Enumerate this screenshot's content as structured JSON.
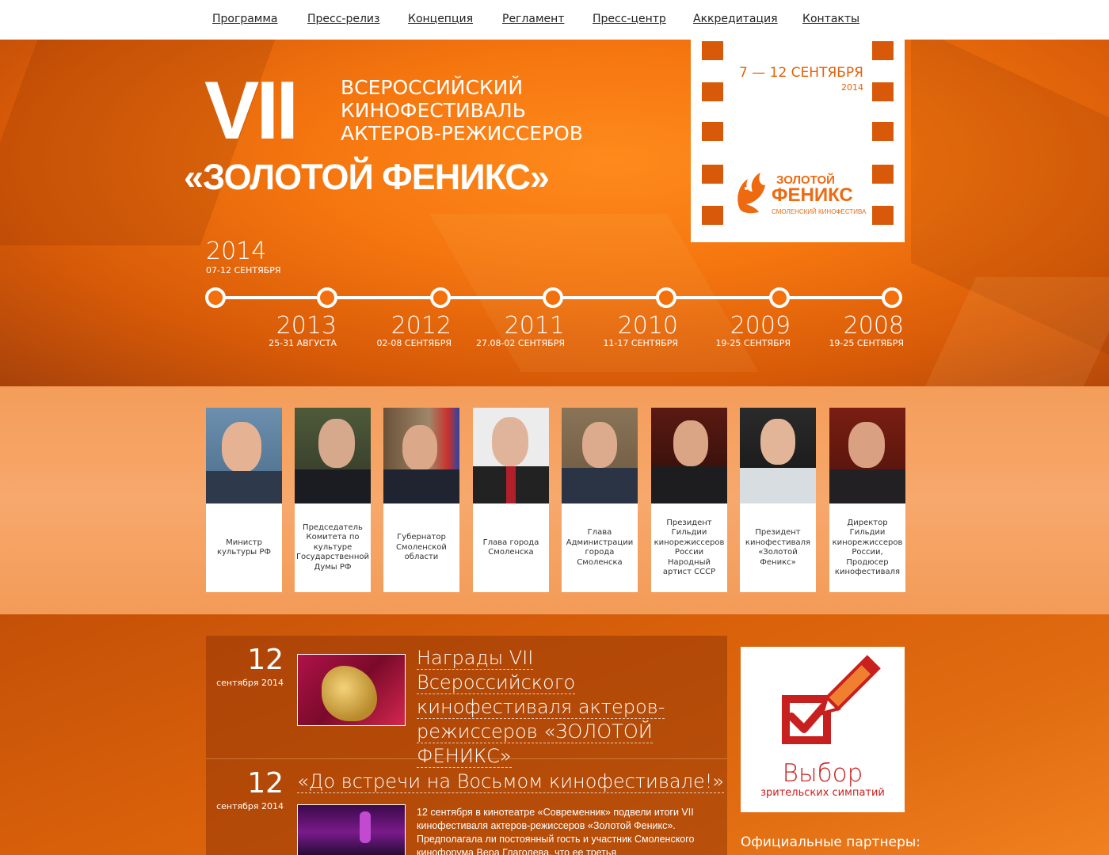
{
  "nav": {
    "items": [
      "Программа",
      "Пресс-релиз",
      "Концепция",
      "Регламент",
      "Пресс-центр",
      "Аккредитация",
      "Контакты"
    ]
  },
  "hero": {
    "numeral": "VII",
    "lines": [
      "ВСЕРОССИЙСКИЙ",
      "КИНОФЕСТИВАЛЬ",
      "АКТЕРОВ-РЕЖИССЕРОВ"
    ],
    "name": "«ЗОЛОТОЙ ФЕНИКС»",
    "film_dates": "7 — 12 СЕНТЯБРЯ",
    "film_year": "2014",
    "logo_top": "ЗОЛОТОЙ",
    "logo_main": "ФЕНИКС",
    "logo_sub": "СМОЛЕНСКИЙ КИНОФЕСТИВАЛЬ"
  },
  "timeline": {
    "current": {
      "year": "2014",
      "dates": "07-12 СЕНТЯБРЯ"
    },
    "past": [
      {
        "year": "2013",
        "dates": "25-31 АВГУСТА"
      },
      {
        "year": "2012",
        "dates": "02-08 СЕНТЯБРЯ"
      },
      {
        "year": "2011",
        "dates": "27.08-02 СЕНТЯБРЯ"
      },
      {
        "year": "2010",
        "dates": "11-17 СЕНТЯБРЯ"
      },
      {
        "year": "2009",
        "dates": "19-25 СЕНТЯБРЯ"
      },
      {
        "year": "2008",
        "dates": "19-25 СЕНТЯБРЯ"
      }
    ]
  },
  "people": [
    {
      "caption": "Министр культуры РФ"
    },
    {
      "caption": "Председатель Комитета по культуре Государственной Думы РФ"
    },
    {
      "caption": "Губернатор Смоленской области"
    },
    {
      "caption": "Глава города Смоленска"
    },
    {
      "caption": "Глава Администрации города Смоленска"
    },
    {
      "caption": "Президент Гильдии кинорежиссеров России Народный артист СССР"
    },
    {
      "caption": "Президент кинофестиваля «Золотой Феникс»"
    },
    {
      "caption": "Директор Гильдии кинорежиссеров России, Продюсер кинофестиваля"
    }
  ],
  "news": [
    {
      "day": "12",
      "month": "сентября 2014",
      "title_lines": [
        "Награды VII Всероссийского",
        "кинофестиваля актеров-",
        "режиссеров «ЗОЛОТОЙ",
        "ФЕНИКС»"
      ]
    },
    {
      "day": "12",
      "month": "сентября 2014",
      "title_lines": [
        "«До встречи на Восьмом кинофестивале!»"
      ],
      "text": "12 сентября в кинотеатре «Современник» подвели итоги VII кинофестиваля актеров-режиссеров «Золотой Феникс». Предполагала ли постоянный гость и участник Смоленского кинофорума Вера Глаголева, что ее третья"
    }
  ],
  "vote": {
    "big": "Выбор",
    "small": "зрительских симпатий"
  },
  "partners_label": "Официальные партнеры:",
  "colors": {
    "accent": "#f3700d",
    "red": "#c8201e"
  }
}
